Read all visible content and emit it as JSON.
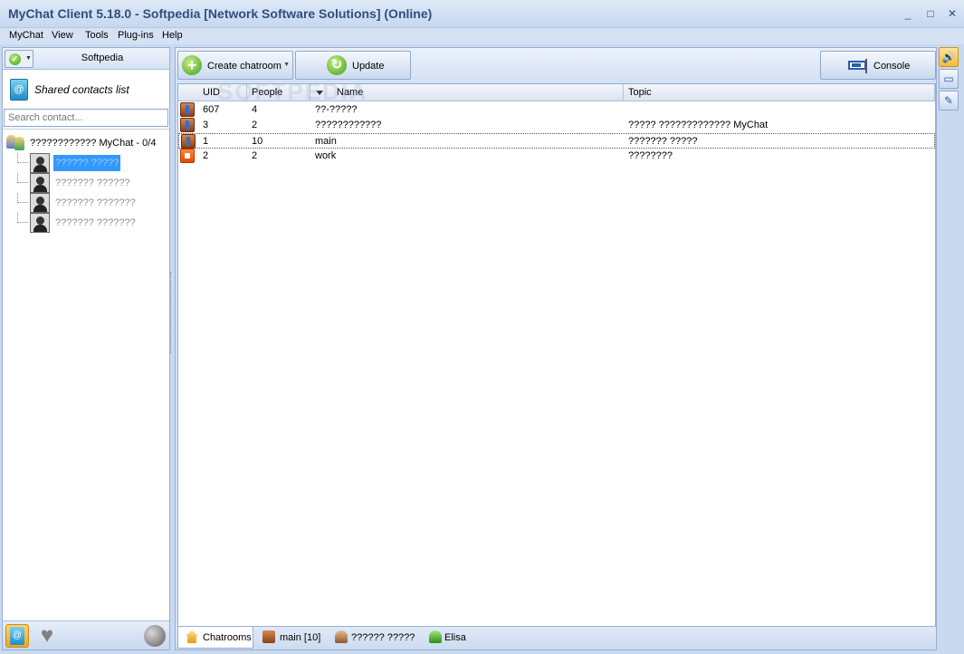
{
  "window": {
    "title": "MyChat Client 5.18.0 - Softpedia [Network Software Solutions] (Online)",
    "controls": {
      "minimize": "_",
      "maximize": "□",
      "close": "✕"
    }
  },
  "menu": [
    "MyChat",
    "View",
    "Tools",
    "Plug-ins",
    "Help"
  ],
  "left_panel": {
    "status_icon": "online-status-icon",
    "username": "Softpedia",
    "shared_contacts_label": "Shared contacts list",
    "search_placeholder": "Search contact...",
    "group": {
      "label": "???????????? MyChat - 0/4"
    },
    "contacts": [
      {
        "name": "?????? ?????",
        "selected": true
      },
      {
        "name": "??????? ??????",
        "selected": false
      },
      {
        "name": "??????? ???????",
        "selected": false
      },
      {
        "name": "??????? ???????",
        "selected": false
      }
    ],
    "bottom_buttons": [
      "contacts-icon",
      "heart-icon",
      "globe-icon"
    ]
  },
  "toolbar": {
    "create_chatroom": "Create chatroom",
    "update": "Update",
    "console": "Console"
  },
  "grid": {
    "columns": [
      "UID",
      "People",
      "Name",
      "Topic"
    ],
    "rows": [
      {
        "uid": "607",
        "people": "4",
        "name": "??-?????",
        "topic": "",
        "icon": "chatroom-icon"
      },
      {
        "uid": "3",
        "people": "2",
        "name": "????????????",
        "topic": "????? ????????????? MyChat",
        "icon": "chatroom-icon"
      },
      {
        "uid": "1",
        "people": "10",
        "name": "main",
        "topic": "??????? ?????",
        "icon": "chatroom-icon",
        "selected": true
      },
      {
        "uid": "2",
        "people": "2",
        "name": "work",
        "topic": "????????",
        "icon": "locked-chatroom-icon"
      }
    ]
  },
  "tabs": [
    {
      "label": "Chatrooms",
      "icon": "home-icon",
      "active": true
    },
    {
      "label": "main [10]",
      "icon": "chatroom-icon",
      "active": false
    },
    {
      "label": "?????? ?????",
      "icon": "user-icon",
      "active": false
    },
    {
      "label": "Elisa",
      "icon": "user-online-icon",
      "active": false
    }
  ],
  "right_strip": [
    "sound-icon",
    "window-icon",
    "pin-icon"
  ],
  "colors": {
    "accent": "#3399ff",
    "frame": "#c9d9ef",
    "online": "#3c9e12"
  }
}
